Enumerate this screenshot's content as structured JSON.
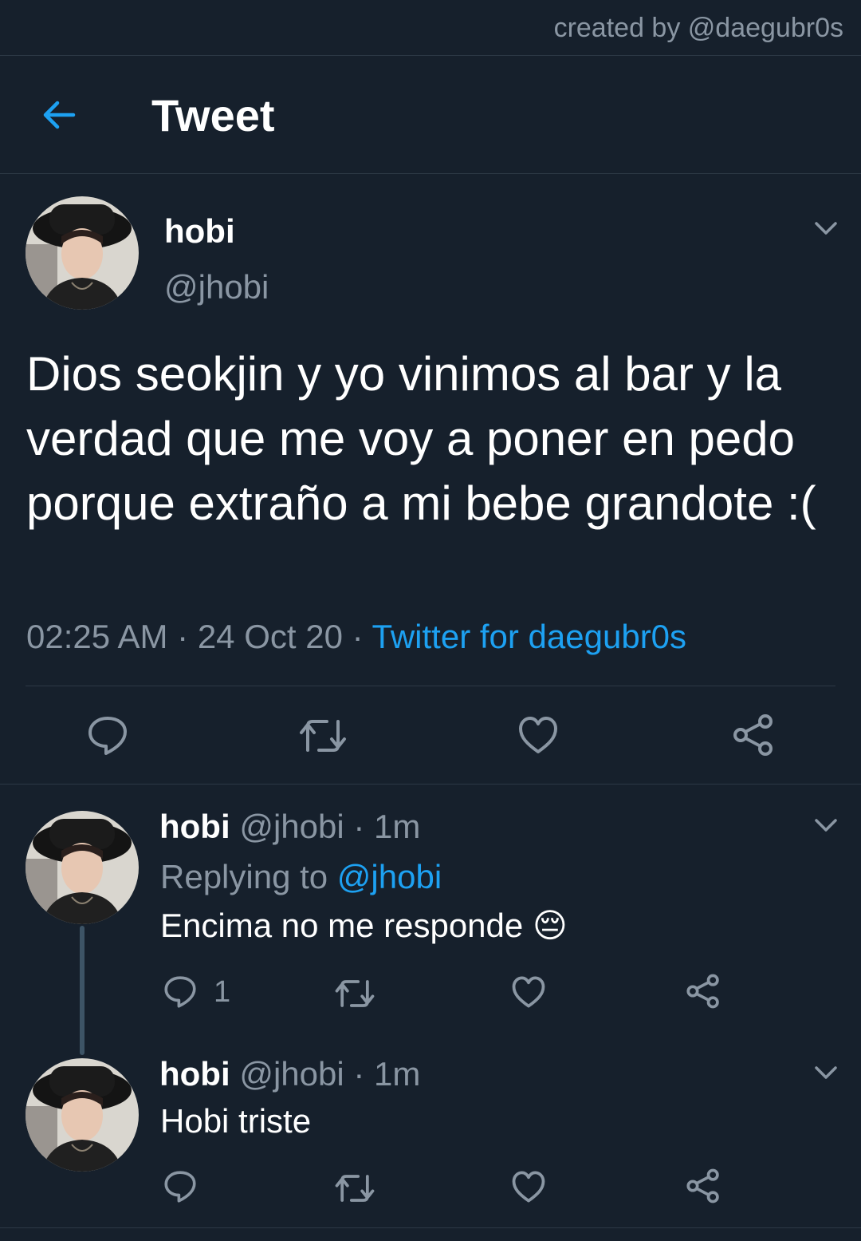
{
  "watermark": "created by @daegubr0s",
  "header": {
    "title": "Tweet",
    "back_icon": "arrow-left-icon"
  },
  "colors": {
    "background": "#16202c",
    "accent": "#1da1f2",
    "muted": "#8a96a3",
    "divider": "#2c3845"
  },
  "main_tweet": {
    "name": "hobi",
    "handle": "@jhobi",
    "text": "Dios seokjin y yo vinimos al bar y la verdad que me voy a poner en pedo porque extraño a mi bebe grandote :(",
    "time": "02:25 AM",
    "date": "24 Oct 20",
    "source": "Twitter for daegubr0s",
    "separator": "·"
  },
  "replies": [
    {
      "name": "hobi",
      "handle": "@jhobi",
      "time": "1m",
      "separator": "·",
      "replying_label": "Replying to",
      "replying_to": "@jhobi",
      "text": "Encima no me responde",
      "emoji": "😔",
      "reply_count": "1"
    },
    {
      "name": "hobi",
      "handle": "@jhobi",
      "time": "1m",
      "separator": "·",
      "text": "Hobi triste"
    }
  ]
}
